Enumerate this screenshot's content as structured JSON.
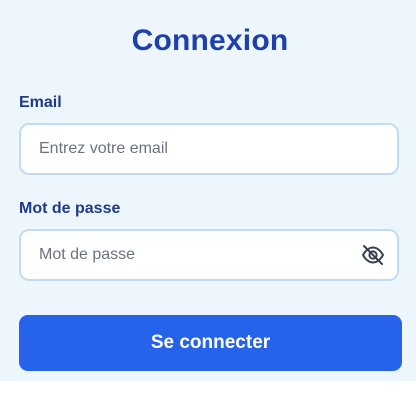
{
  "title": "Connexion",
  "email": {
    "label": "Email",
    "placeholder": "Entrez votre email",
    "value": ""
  },
  "password": {
    "label": "Mot de passe",
    "placeholder": "Mot de passe",
    "value": "",
    "toggle_icon": "eye-off-icon"
  },
  "submit": {
    "label": "Se connecter"
  },
  "colors": {
    "background": "#eef6fd",
    "title": "#1e40af",
    "label": "#1e3a8a",
    "button": "#2563eb",
    "input_border": "#bfdcf3"
  }
}
